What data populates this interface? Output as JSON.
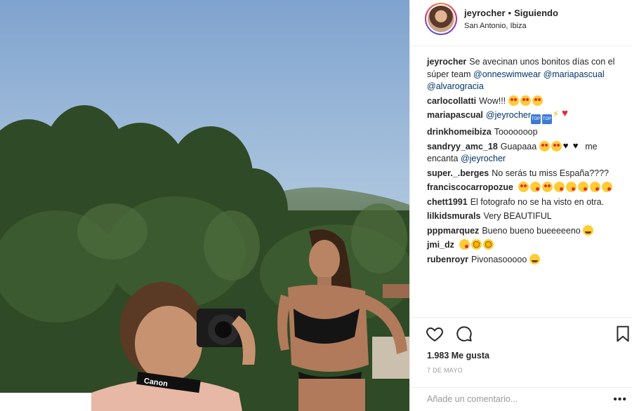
{
  "post": {
    "username": "jeyrocher",
    "separator": "•",
    "follow_status": "Siguiendo",
    "location": "San Antonio, Ibiza",
    "photo_text": "Canon"
  },
  "caption": {
    "user": "jeyrocher",
    "text": "Se avecinan unos bonitos días con el súper team",
    "mentions": [
      "@onneswimwear",
      "@mariapascual",
      "@alvarogracia"
    ]
  },
  "comments": [
    {
      "user": "carlocollatti",
      "text": "Wow!!!",
      "emojis": [
        "heart-eyes",
        "heart-eyes",
        "heart-eyes"
      ]
    },
    {
      "user": "mariapascual",
      "mention": "@jeyrocher",
      "emojis": [
        "top",
        "top",
        "bolt",
        "red-heart"
      ]
    },
    {
      "user": "drinkhomeibiza",
      "text": "Tooooooop"
    },
    {
      "user": "sandryy_amc_18",
      "text": "Guapaaa",
      "emojis": [
        "heart-eyes",
        "heart-eyes",
        "black-heart",
        "black-heart"
      ],
      "text2": "me encanta",
      "mention": "@jeyrocher"
    },
    {
      "user": "super._.berges",
      "text": "No serás tu miss España????"
    },
    {
      "user": "franciscocarropozue",
      "emojis": [
        "heart-eyes",
        "wink",
        "heart-eyes",
        "wink",
        "wink",
        "wink",
        "wink",
        "wink"
      ]
    },
    {
      "user": "chett1991",
      "text": "El fotografo no se ha visto en otra."
    },
    {
      "user": "lilkidsmurals",
      "text": "Very BEAUTIFUL"
    },
    {
      "user": "pppmarquez",
      "text": "Bueno bueno bueeeeeno",
      "emojis": [
        "grin"
      ]
    },
    {
      "user": "jmi_dz",
      "emojis": [
        "wink",
        "sun",
        "sun"
      ]
    },
    {
      "user": "rubenroyr",
      "text": "Pivonasooooo",
      "emojis": [
        "grin"
      ]
    }
  ],
  "actions": {
    "like_icon": "heart-outline-icon",
    "comment_icon": "comment-bubble-icon",
    "save_icon": "bookmark-icon",
    "likes_text": "1.983 Me gusta",
    "date": "7 DE MAYO"
  },
  "add_comment": {
    "placeholder": "Añade un comentario...",
    "more_label": "•••"
  }
}
